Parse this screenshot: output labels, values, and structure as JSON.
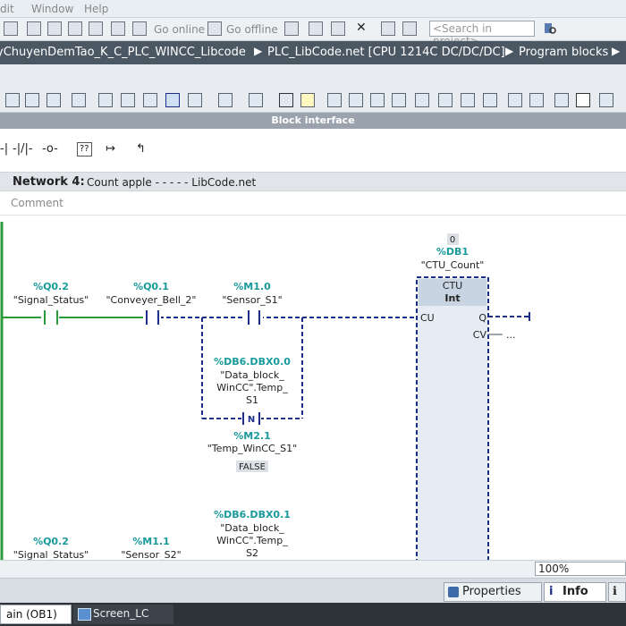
{
  "menu": {
    "items": [
      "dit",
      "Window",
      "Help"
    ]
  },
  "toolbar": {
    "go_online": "Go online",
    "go_offline": "Go offline",
    "search_placeholder": "<Search in project>"
  },
  "breadcrumb": [
    "yChuyenDemTao_K_C_PLC_WINCC_Libcode",
    "PLC_LibCode.net [CPU 1214C DC/DC/DC]",
    "Program blocks"
  ],
  "block_interface": "Block interface",
  "network": {
    "title": "Network 4:",
    "comment_text": "Count apple - - - - - LibCode.net",
    "comment_placeholder": "Comment"
  },
  "ladder": {
    "contacts": [
      {
        "address": "%Q0.2",
        "name": "\"Signal_Status\""
      },
      {
        "address": "%Q0.1",
        "name": "\"Conveyer_Bell_2\""
      },
      {
        "address": "%M1.0",
        "name": "\"Sensor_S1\""
      }
    ],
    "branch": {
      "address": "%DB6.DBX0.0",
      "name_lines": [
        "\"Data_block_",
        "WinCC\".Temp_",
        "S1"
      ],
      "edge_label": "N",
      "edge_address": "%M2.1",
      "edge_name": "\"Temp_WinCC_S1\"",
      "edge_value": "FALSE"
    },
    "counter": {
      "value": "0",
      "instance": "%DB1",
      "instance_name": "\"CTU_Count\"",
      "type": "CTU",
      "data_type": "Int",
      "pin_cu": "CU",
      "pin_q": "Q",
      "pin_cv": "CV",
      "cv_value": "..."
    },
    "row2_contacts": [
      {
        "address": "%Q0.2",
        "name": "\"Signal_Status\""
      },
      {
        "address": "%M1.1",
        "name": "\"Sensor_S2\""
      }
    ],
    "row2_branch": {
      "address": "%DB6.DBX0.1",
      "name_lines": [
        "\"Data_block_",
        "WinCC\".Temp_",
        "S2"
      ]
    }
  },
  "status": {
    "zoom": "100%"
  },
  "panel_tabs": {
    "properties": "Properties",
    "info": "Info"
  },
  "taskbar": {
    "main": "ain (OB1)",
    "screen": "Screen_LC"
  },
  "colors": {
    "address": "#1a9a9a",
    "wire_dashed": "#1b2e8a",
    "wire_solid": "#2a9a3a",
    "box_fill": "#e6ecf4"
  }
}
